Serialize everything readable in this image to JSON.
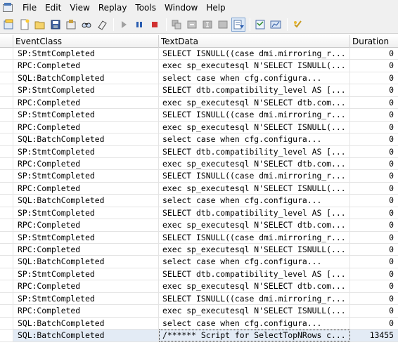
{
  "menu": [
    "File",
    "Edit",
    "View",
    "Replay",
    "Tools",
    "Window",
    "Help"
  ],
  "toolbar": {
    "icons": [
      "new-trace-icon",
      "new-file-icon",
      "open-icon",
      "save-icon",
      "properties-icon",
      "find-icon",
      "clear-icon",
      "run-icon",
      "pause-icon",
      "stop-icon",
      "replay-icon",
      "step-icon",
      "cursor-icon",
      "auto-scroll-icon",
      "template-icon",
      "chart-icon",
      "help-icon"
    ]
  },
  "columns": {
    "event_class": "EventClass",
    "text_data": "TextData",
    "duration": "Duration"
  },
  "rows": [
    {
      "event": "SP:StmtCompleted",
      "text": "SELECT ISNULL((case dmi.mirroring_r...",
      "duration": "0"
    },
    {
      "event": "RPC:Completed",
      "text": "exec sp_executesql N'SELECT ISNULL(...",
      "duration": "0"
    },
    {
      "event": "SQL:BatchCompleted",
      "text": "select    case    when cfg.configura...",
      "duration": "0"
    },
    {
      "event": "SP:StmtCompleted",
      "text": "SELECT dtb.compatibility_level AS [...",
      "duration": "0"
    },
    {
      "event": "RPC:Completed",
      "text": "exec sp_executesql N'SELECT dtb.com...",
      "duration": "0"
    },
    {
      "event": "SP:StmtCompleted",
      "text": "SELECT ISNULL((case dmi.mirroring_r...",
      "duration": "0"
    },
    {
      "event": "RPC:Completed",
      "text": "exec sp_executesql N'SELECT ISNULL(...",
      "duration": "0"
    },
    {
      "event": "SQL:BatchCompleted",
      "text": "select    case    when cfg.configura...",
      "duration": "0"
    },
    {
      "event": "SP:StmtCompleted",
      "text": "SELECT dtb.compatibility_level AS [...",
      "duration": "0"
    },
    {
      "event": "RPC:Completed",
      "text": "exec sp_executesql N'SELECT dtb.com...",
      "duration": "0"
    },
    {
      "event": "SP:StmtCompleted",
      "text": "SELECT ISNULL((case dmi.mirroring_r...",
      "duration": "0"
    },
    {
      "event": "RPC:Completed",
      "text": "exec sp_executesql N'SELECT ISNULL(...",
      "duration": "0"
    },
    {
      "event": "SQL:BatchCompleted",
      "text": "select    case    when cfg.configura...",
      "duration": "0"
    },
    {
      "event": "SP:StmtCompleted",
      "text": "SELECT dtb.compatibility_level AS [...",
      "duration": "0"
    },
    {
      "event": "RPC:Completed",
      "text": "exec sp_executesql N'SELECT dtb.com...",
      "duration": "0"
    },
    {
      "event": "SP:StmtCompleted",
      "text": "SELECT ISNULL((case dmi.mirroring_r...",
      "duration": "0"
    },
    {
      "event": "RPC:Completed",
      "text": "exec sp_executesql N'SELECT ISNULL(...",
      "duration": "0"
    },
    {
      "event": "SQL:BatchCompleted",
      "text": "select    case    when cfg.configura...",
      "duration": "0"
    },
    {
      "event": "SP:StmtCompleted",
      "text": "SELECT dtb.compatibility_level AS [...",
      "duration": "0"
    },
    {
      "event": "RPC:Completed",
      "text": "exec sp_executesql N'SELECT dtb.com...",
      "duration": "0"
    },
    {
      "event": "SP:StmtCompleted",
      "text": "SELECT ISNULL((case dmi.mirroring_r...",
      "duration": "0"
    },
    {
      "event": "RPC:Completed",
      "text": "exec sp_executesql N'SELECT ISNULL(...",
      "duration": "0"
    },
    {
      "event": "SQL:BatchCompleted",
      "text": "select    case    when cfg.configura...",
      "duration": "0"
    },
    {
      "event": "SQL:BatchCompleted",
      "text": "/****** Script for SelectTopNRows c...",
      "duration": "13455",
      "selected": true
    }
  ]
}
